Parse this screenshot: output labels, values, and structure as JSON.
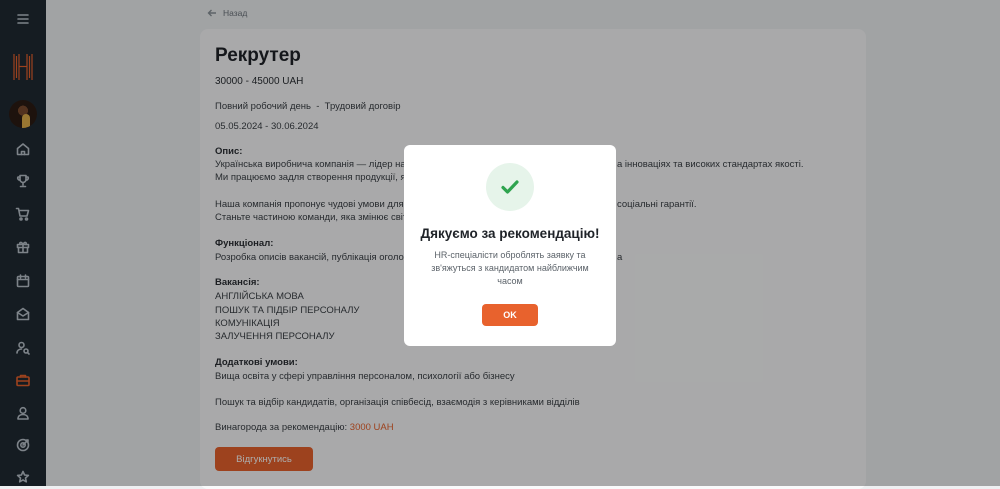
{
  "theme": {
    "accent": "#e8622d",
    "sidebar_bg": "#1f2a33",
    "success": "#2fa44f"
  },
  "sidebar": {
    "menu_icon": "hamburger-menu-icon",
    "logo": "H-logo",
    "items": [
      {
        "icon": "home-icon"
      },
      {
        "icon": "trophy-icon"
      },
      {
        "icon": "cart-icon"
      },
      {
        "icon": "gift-icon"
      },
      {
        "icon": "calendar-icon"
      },
      {
        "icon": "mail-open-icon"
      },
      {
        "icon": "user-search-icon"
      },
      {
        "icon": "briefcase-icon",
        "active": true
      },
      {
        "icon": "user-icon"
      },
      {
        "icon": "target-icon"
      },
      {
        "icon": "star-icon"
      }
    ]
  },
  "nav": {
    "back_label": "Назад"
  },
  "vacancy": {
    "title": "Рекрутер",
    "salary": "30000 - 45000 UAH",
    "terms": "Повний робочий день  -  Трудовий договір",
    "dates": "05.05.2024 - 30.06.2024",
    "description_label": "Опис:",
    "description_line1_left": "Українська виробнича компанія — лідер на рин",
    "description_line1_right": "а інноваціях та високих стандартах якості.",
    "description_line2_left": "Ми працюємо задля створення продукції, яка в",
    "description_line3_left": "Наша компанія пропонує чудові умови для про",
    "description_line3_right": "соціальні гарантії.",
    "description_line4_left": "Станьте частиною команди, яка змінює світ ви",
    "functional_label": "Функціонал:",
    "functional_line_left": "Розробка описів вакансій, публікація оголошен",
    "functional_line_right": "а",
    "skills_label": "Вакансія:",
    "skills": [
      "АНГЛІЙСЬКА МОВА",
      "ПОШУК ТА ПІДБІР ПЕРСОНАЛУ",
      "КОМУНІКАЦІЯ",
      "ЗАЛУЧЕННЯ ПЕРСОНАЛУ"
    ],
    "extra_label": "Додаткові умови:",
    "extra_line": "Вища освіта у сфері управління персоналом, психології або бізнесу",
    "duties_line": "Пошук та відбір кандидатів, організація співбесід, взаємодія з керівниками відділів",
    "reward_label": "Винагорода за рекомендацію:",
    "reward_value": "3000 UAH",
    "apply_label": "Відгукнутись"
  },
  "modal": {
    "icon": "check-icon",
    "title": "Дякуємо за рекомендацію!",
    "message": "HR-спеціалісти оброблять заявку та зв'яжуться з кандидатом найближчим часом",
    "ok_label": "OK"
  }
}
